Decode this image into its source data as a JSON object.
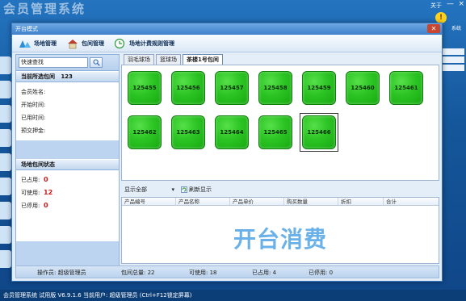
{
  "background": {
    "app_title": "会员管理系统",
    "about_label": "关于",
    "minimize_glyph": "—",
    "close_glyph": "×",
    "warn_label": "系统",
    "status_text": "会员管理系统 试用版 V6.9.1.6 当前用户: 超级管理员  (Ctrl+F12锁定屏幕)"
  },
  "dialog": {
    "title": "开台模式",
    "close_glyph": "✕",
    "toolbar": [
      {
        "label": "场地管理",
        "icon": "venue-icon"
      },
      {
        "label": "包间管理",
        "icon": "room-icon"
      },
      {
        "label": "场地计费规则管理",
        "icon": "billing-icon"
      }
    ]
  },
  "left": {
    "search_value": "快速查找",
    "current_label": "当前所选包间",
    "current_value": "123",
    "fields": [
      "会员姓名:",
      "开始时间:",
      "已用时间:",
      "预交押金:"
    ],
    "status_title": "场地包间状态",
    "status": [
      {
        "label": "已占用:",
        "value": "0"
      },
      {
        "label": "可使用:",
        "value": "12"
      },
      {
        "label": "已停用:",
        "value": "0"
      }
    ]
  },
  "tabs": [
    "羽毛球场",
    "篮球场",
    "茶楼1号包间"
  ],
  "rooms": [
    "125455",
    "125456",
    "125457",
    "125458",
    "125459",
    "125460",
    "125461",
    "125462",
    "125463",
    "125464",
    "125465",
    "125466"
  ],
  "selected_room": "125466",
  "colors": {
    "room_green": "#2cc424",
    "status_red": "#d01818",
    "watermark": "#4fa4e4"
  },
  "filter": {
    "show_value": "显示全部",
    "refresh_label": "刷新显示"
  },
  "grid": {
    "columns": [
      "产品编号",
      "产品名称",
      "产品单价",
      "购买数量",
      "折扣",
      "合计"
    ],
    "watermark": "开台消费"
  },
  "footer": {
    "operator_label": "操作员:",
    "operator_value": "超级管理员",
    "total": "包间总量:  22",
    "available": "可使用:  18",
    "occupied": "已占用:  4",
    "disabled": "已停用:  0"
  }
}
